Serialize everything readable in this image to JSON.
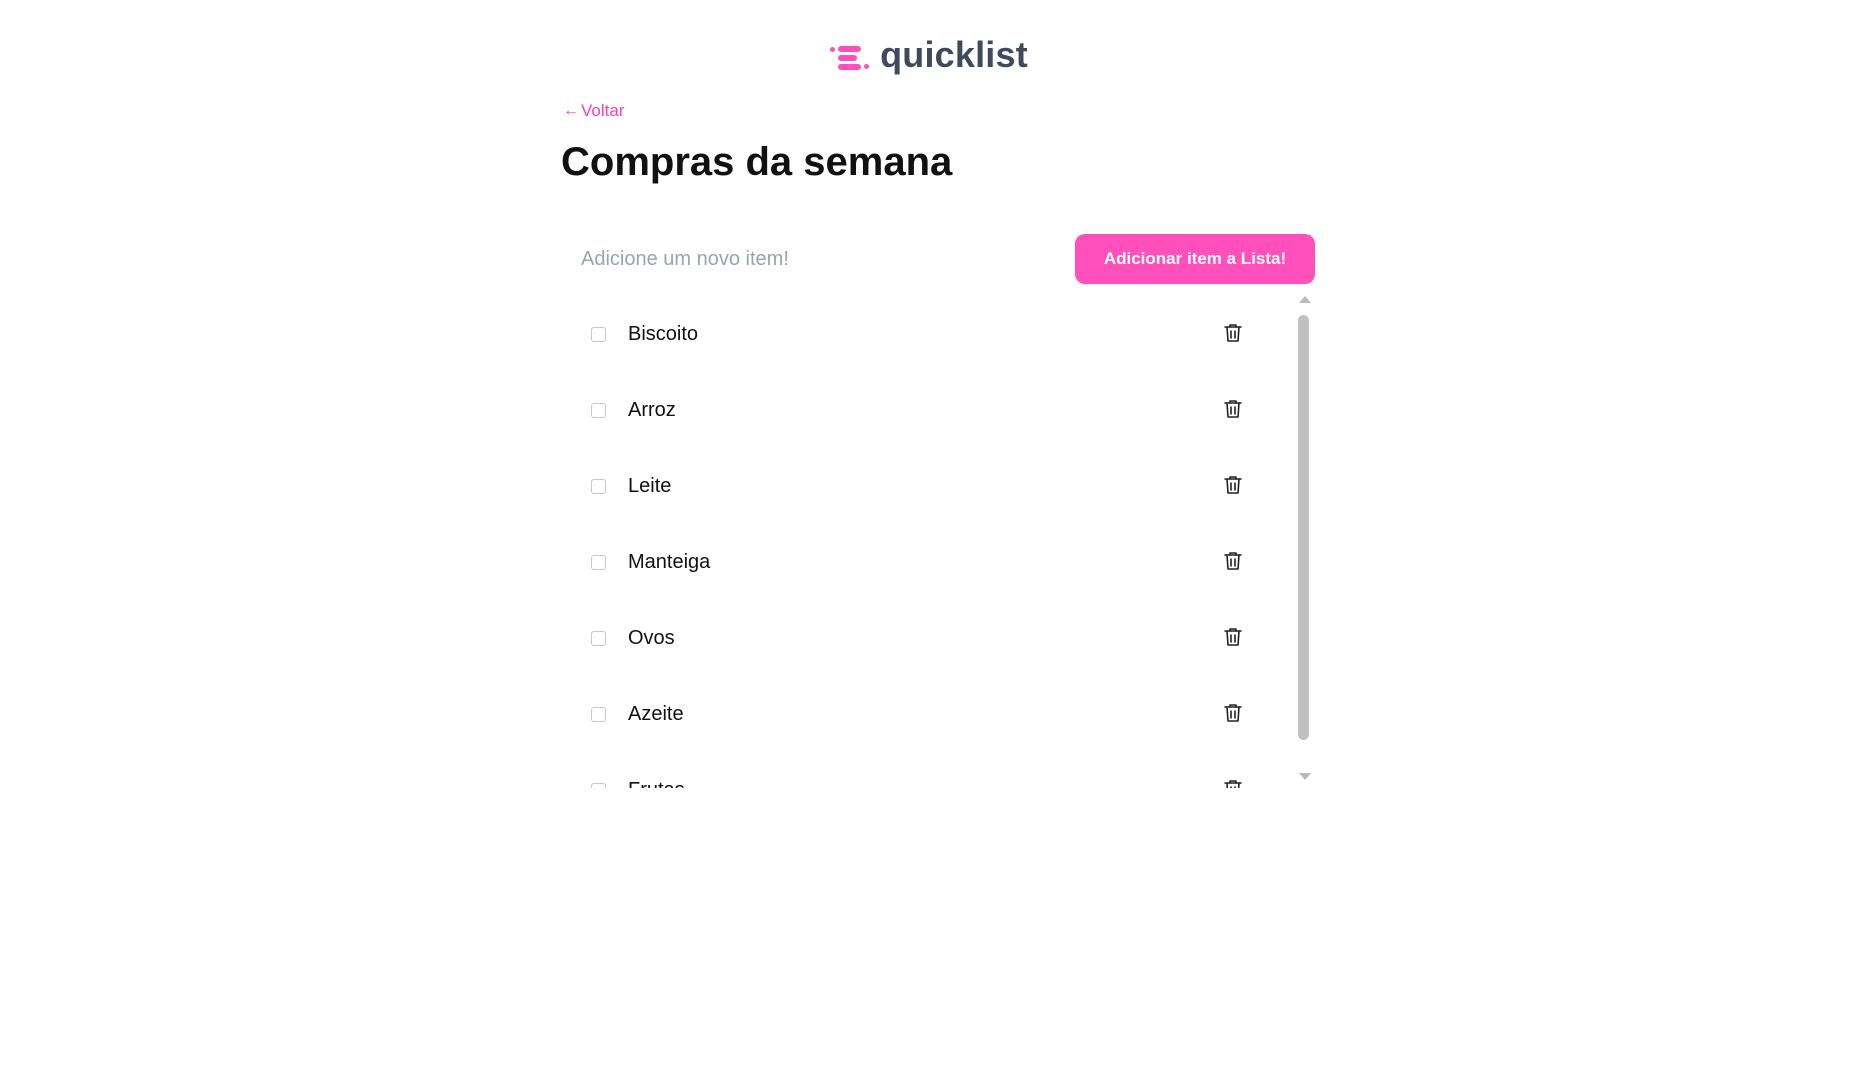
{
  "app": {
    "logo_text": "quicklist"
  },
  "nav": {
    "back_label": "Voltar"
  },
  "page": {
    "title": "Compras da semana"
  },
  "add_form": {
    "placeholder": "Adicione um novo item!",
    "value": "",
    "button_label": "Adicionar item a Lista!"
  },
  "items": [
    {
      "label": "Biscoito",
      "checked": false
    },
    {
      "label": "Arroz",
      "checked": false
    },
    {
      "label": "Leite",
      "checked": false
    },
    {
      "label": "Manteiga",
      "checked": false
    },
    {
      "label": "Ovos",
      "checked": false
    },
    {
      "label": "Azeite",
      "checked": false
    },
    {
      "label": "Frutas",
      "checked": false
    }
  ],
  "colors": {
    "accent": "#ff4fbb",
    "logo_text": "#3f4a5c",
    "title": "#111111",
    "placeholder": "#9ca3af"
  },
  "icons": {
    "logo": "list-lines-icon",
    "back": "arrow-left-icon",
    "delete": "trash-icon"
  }
}
